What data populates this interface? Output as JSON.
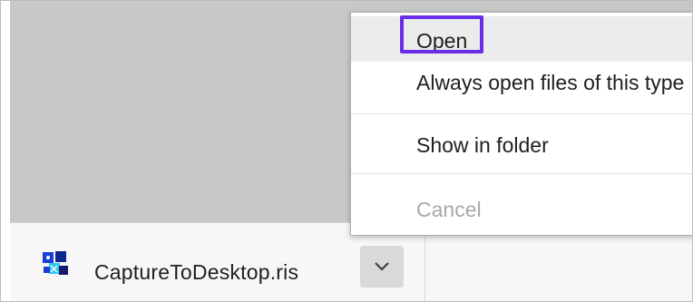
{
  "download": {
    "file_name": "CaptureToDesktop.ris",
    "file_icon": "ris-file-icon"
  },
  "menu": {
    "items": [
      {
        "label": "Open",
        "enabled": true,
        "highlighted": true
      },
      {
        "label": "Always open files of this type",
        "enabled": true
      },
      {
        "label": "Show in folder",
        "enabled": true
      },
      {
        "label": "Cancel",
        "enabled": false
      }
    ]
  },
  "colors": {
    "highlight_outline": "#6a2ee8",
    "disabled_text": "#a8a8a8"
  }
}
